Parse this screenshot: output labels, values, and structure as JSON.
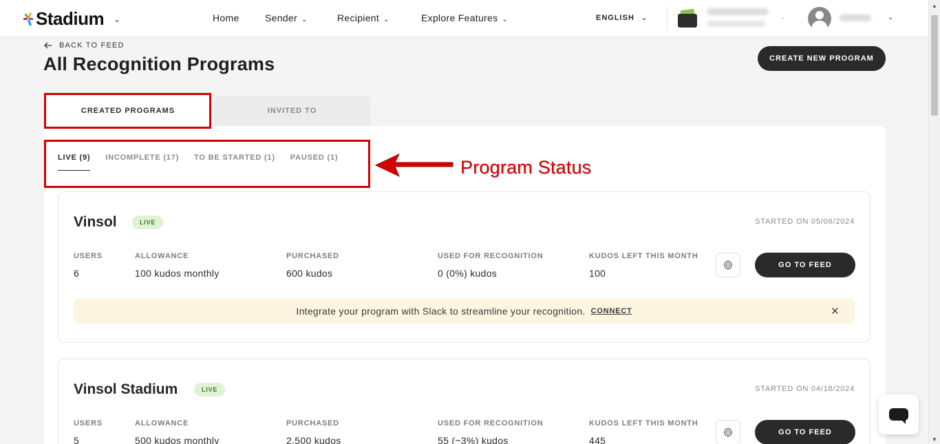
{
  "header": {
    "logo_text": "Stadium",
    "nav": [
      {
        "label": "Home"
      },
      {
        "label": "Sender"
      },
      {
        "label": "Recipient"
      },
      {
        "label": "Explore Features"
      }
    ],
    "language": "ENGLISH"
  },
  "page": {
    "back_label": "BACK TO FEED",
    "title": "All Recognition Programs",
    "create_label": "CREATE NEW PROGRAM"
  },
  "tabs": [
    {
      "label": "CREATED PROGRAMS",
      "active": true
    },
    {
      "label": "INVITED TO",
      "active": false
    }
  ],
  "status_tabs": [
    {
      "label": "LIVE (9)",
      "active": true
    },
    {
      "label": "INCOMPLETE (17)",
      "active": false
    },
    {
      "label": "TO BE STARTED (1)",
      "active": false
    },
    {
      "label": "PAUSED (1)",
      "active": false
    }
  ],
  "annotation": {
    "label": "Program Status",
    "color": "#d40000"
  },
  "stat_labels": [
    "USERS",
    "ALLOWANCE",
    "PURCHASED",
    "USED FOR RECOGNITION",
    "KUDOS LEFT THIS MONTH"
  ],
  "programs": [
    {
      "name": "Vinsol",
      "badge": "LIVE",
      "started": "STARTED ON 05/06/2024",
      "values": [
        "6",
        "100 kudos monthly",
        "600 kudos",
        "0 (0%) kudos",
        "100"
      ],
      "feed_label": "GO TO FEED",
      "slack_text": "Integrate your program with Slack to streamline your recognition.",
      "connect_label": "CONNECT"
    },
    {
      "name": "Vinsol Stadium",
      "badge": "LIVE",
      "started": "STARTED ON 04/18/2024",
      "values": [
        "5",
        "500 kudos monthly",
        "2,500 kudos",
        "55 (~3%) kudos",
        "445"
      ],
      "feed_label": "GO TO FEED"
    }
  ],
  "colors": {
    "accent_dark": "#2a2a2a",
    "live_badge_bg": "#dff2d4",
    "live_badge_text": "#3d7a2a",
    "slack_banner_bg": "#fdf5e1"
  }
}
